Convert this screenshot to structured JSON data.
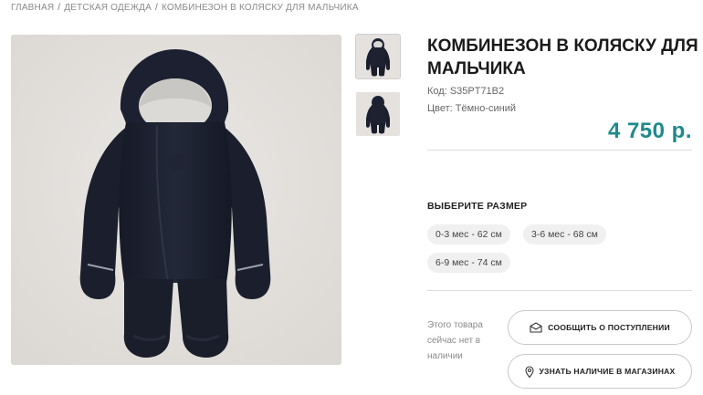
{
  "breadcrumb": {
    "items": [
      {
        "label": "ГЛАВНАЯ"
      },
      {
        "label": "ДЕТСКАЯ ОДЕЖДА"
      },
      {
        "label": "КОМБИНЕЗОН В КОЛЯСКУ ДЛЯ МАЛЬЧИКА"
      }
    ],
    "separator": "/"
  },
  "gallery": {
    "main_image_icon": "snowsuit-photo",
    "thumbnails": [
      {
        "icon": "snowsuit-front-thumbnail"
      },
      {
        "icon": "snowsuit-back-thumbnail"
      }
    ]
  },
  "product": {
    "title": "КОМБИНЕЗОН В КОЛЯСКУ ДЛЯ МАЛЬЧИКА",
    "code": "Код: S35PT71B2",
    "color": "Цвет: Тёмно-синий",
    "price": "4 750 р."
  },
  "sizes": {
    "heading": "ВЫБЕРИТЕ РАЗМЕР",
    "options": [
      "0-3 мес - 62 см",
      "3-6 мес - 68 см",
      "6-9 мес - 74 см"
    ]
  },
  "availability": {
    "note": "Этого товара сейчас нет в наличии",
    "notify_label": "СООБЩИТЬ О ПОСТУПЛЕНИИ",
    "notify_icon": "envelope-icon",
    "stores_label": "УЗНАТЬ НАЛИЧИЕ В МАГАЗИНАХ",
    "stores_icon": "map-pin-icon"
  },
  "colors": {
    "accent_price": "#1f8a8c",
    "garment": "#1d2130",
    "photo_bg": "#e3e0dd"
  }
}
